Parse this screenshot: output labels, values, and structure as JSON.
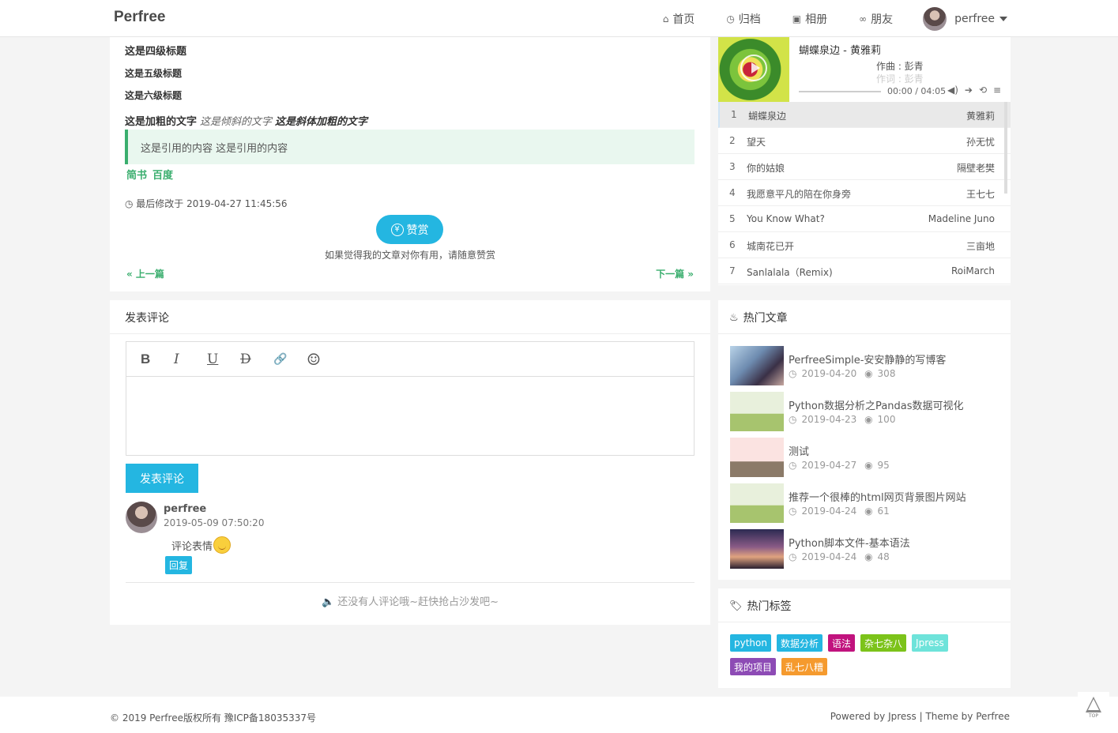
{
  "header": {
    "brand": "Perfree",
    "nav": [
      {
        "icon": "home-icon",
        "glyph": "⌂",
        "label": "首页"
      },
      {
        "icon": "clock-icon",
        "glyph": "◷",
        "label": "归档"
      },
      {
        "icon": "image-icon",
        "glyph": "▣",
        "label": "相册"
      },
      {
        "icon": "link-icon",
        "glyph": "∞",
        "label": "朋友"
      }
    ],
    "user": "perfree"
  },
  "article": {
    "h4": "这是四级标题",
    "h5": "这是五级标题",
    "h6": "这是六级标题",
    "bold": "这是加粗的文字",
    "italic": "这是倾斜的文字",
    "bold_italic": "这是斜体加粗的文字",
    "quote": "这是引用的内容 这是引用的内容",
    "link1": "简书",
    "link2": "百度",
    "modified": "最后修改于 2019-04-27 11:45:56",
    "reward_label": "赞赏",
    "reward_tip": "如果觉得我的文章对你有用，请随意赞赏",
    "prev": "« 上一篇",
    "next": "下一篇 »"
  },
  "comments": {
    "title": "发表评论",
    "toolbar": [
      "B",
      "I",
      "U",
      "D",
      "🔗",
      "☺"
    ],
    "submit": "发表评论",
    "items": [
      {
        "name": "perfree",
        "time": "2019-05-09 07:50:20",
        "text": "评论表情",
        "reply": "回复"
      }
    ],
    "empty": "🔈 还没有人评论哦~赶快抢占沙发吧~"
  },
  "player": {
    "now_playing": "蝴蝶泉边 - 黄雅莉",
    "lyric_line1": "作曲 : 彭青",
    "lyric_line2": "作词 : 彭青",
    "time": "00:00 / 04:05",
    "progress": 0,
    "playlist": [
      {
        "n": "1",
        "name": "蝴蝶泉边",
        "artist": "黄雅莉"
      },
      {
        "n": "2",
        "name": "望天",
        "artist": "孙无忧"
      },
      {
        "n": "3",
        "name": "你的姑娘",
        "artist": "隔壁老樊"
      },
      {
        "n": "4",
        "name": "我愿意平凡的陪在你身旁",
        "artist": "王七七"
      },
      {
        "n": "5",
        "name": "You Know What?",
        "artist": "Madeline Juno"
      },
      {
        "n": "6",
        "name": "城南花已开",
        "artist": "三亩地"
      },
      {
        "n": "7",
        "name": "Sanlalala（Remix)",
        "artist": "RoiMarch"
      }
    ]
  },
  "hot": {
    "title": "热门文章",
    "posts": [
      {
        "title": "PerfreeSimple-安安静静的写博客",
        "date": "2019-04-20",
        "views": "308"
      },
      {
        "title": "Python数据分析之Pandas数据可视化",
        "date": "2019-04-23",
        "views": "100"
      },
      {
        "title": "测试",
        "date": "2019-04-27",
        "views": "95"
      },
      {
        "title": "推荐一个很棒的html网页背景图片网站",
        "date": "2019-04-24",
        "views": "61"
      },
      {
        "title": "Python脚本文件-基本语法",
        "date": "2019-04-24",
        "views": "48"
      }
    ]
  },
  "tags": {
    "title": "热门标签",
    "items": [
      {
        "label": "python",
        "color": "#24b6e1"
      },
      {
        "label": "数据分析",
        "color": "#24b6e1"
      },
      {
        "label": "语法",
        "color": "#c1137e"
      },
      {
        "label": "杂七杂八",
        "color": "#7cc31a"
      },
      {
        "label": "Jpress",
        "color": "#6ee3da"
      },
      {
        "label": "我的项目",
        "color": "#8d4bb5"
      },
      {
        "label": "乱七八糟",
        "color": "#f59a2e"
      }
    ]
  },
  "footer": {
    "copyright": "© 2019 Perfree版权所有 豫ICP备18035337号",
    "powered": "Powered by  Jpress | Theme by  Perfree",
    "top": "TOP"
  }
}
